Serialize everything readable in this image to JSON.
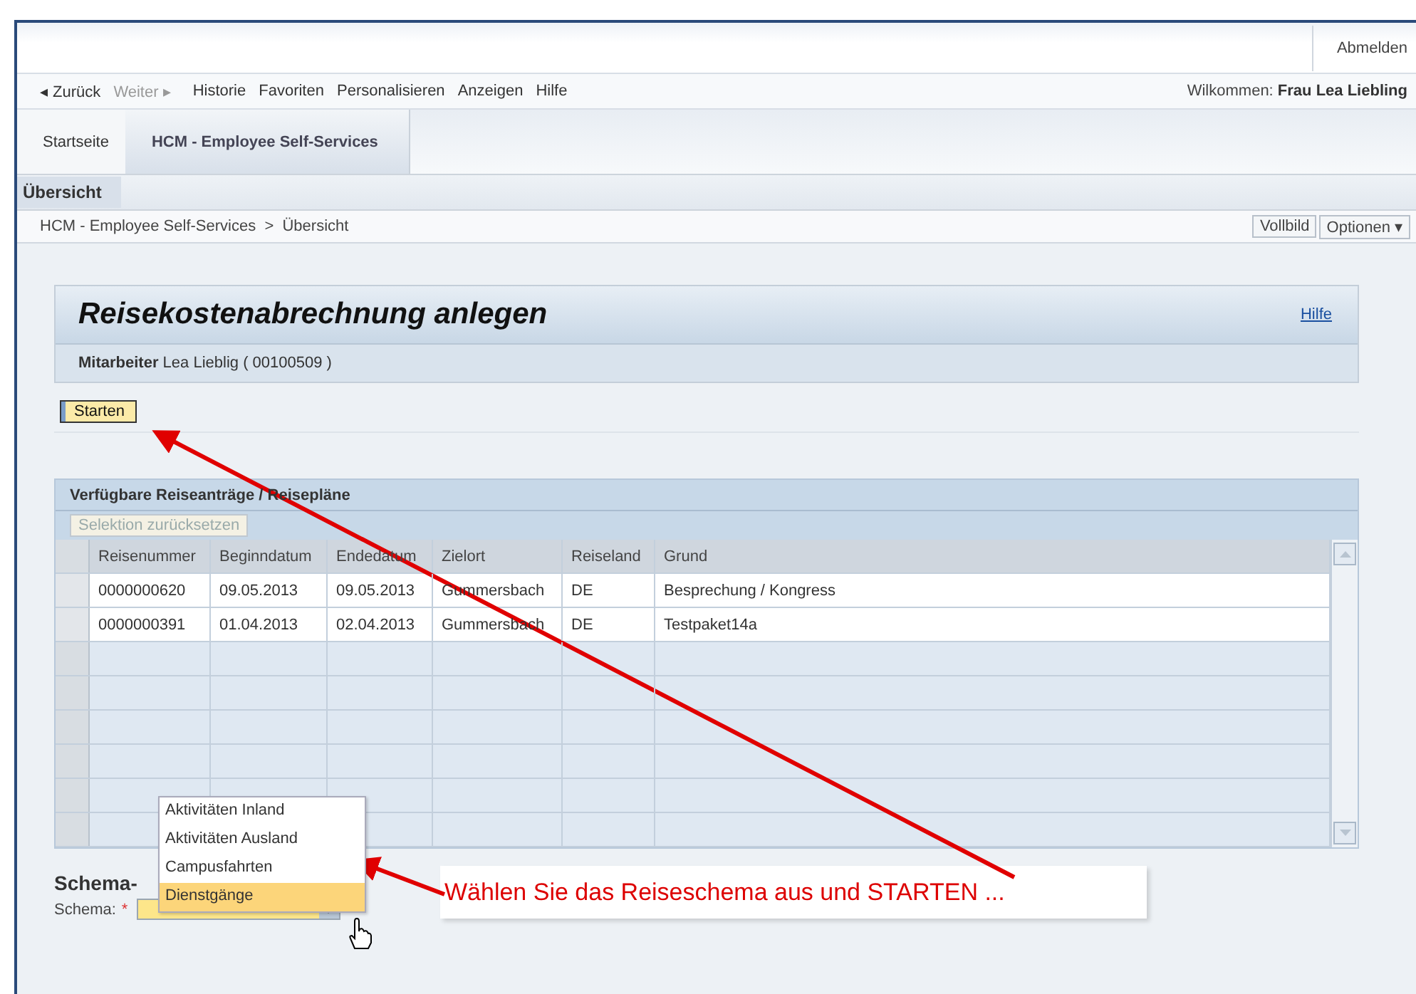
{
  "header": {
    "logout": "Abmelden"
  },
  "nav": {
    "back": "◂ Zurück",
    "forward": "Weiter ▸",
    "items": [
      "Historie",
      "Favoriten",
      "Personalisieren",
      "Anzeigen",
      "Hilfe"
    ],
    "welcome_label": "Wilkommen:",
    "welcome_name": "Frau Lea Liebling"
  },
  "tabs": [
    {
      "label": "Startseite",
      "selected": false
    },
    {
      "label": "HCM - Employee Self-Services",
      "selected": true
    }
  ],
  "subtabs": [
    {
      "label": "Übersicht",
      "selected": true
    }
  ],
  "breadcrumb": {
    "text": "HCM - Employee Self-Services  >  Übersicht",
    "buttons": [
      "Vollbild",
      "Optionen ▾"
    ]
  },
  "page": {
    "title": "Reisekostenabrechnung anlegen",
    "help": "Hilfe",
    "employee_label": "Mitarbeiter",
    "employee_value": "Lea Lieblig ( 00100509 )",
    "start_button": "Starten"
  },
  "table": {
    "title": "Verfügbare Reiseanträge / Reisepläne",
    "reset_button": "Selektion zurücksetzen",
    "disabled_reset": true,
    "columns": [
      "Reisenummer",
      "Beginndatum",
      "Endedatum",
      "Zielort",
      "Reiseland",
      "Grund"
    ],
    "rows": [
      [
        "0000000620",
        "09.05.2013",
        "09.05.2013",
        "Gummersbach",
        "DE",
        "Besprechung / Kongress"
      ],
      [
        "0000000391",
        "01.04.2013",
        "02.04.2013",
        "Gummersbach",
        "DE",
        "Testpaket14a"
      ]
    ]
  },
  "schema": {
    "heading": "Schema-",
    "label": "Schema:",
    "required_mark": "*",
    "options": [
      {
        "label": "Aktivitäten Inland",
        "selected": false
      },
      {
        "label": "Aktivitäten Ausland",
        "selected": false
      },
      {
        "label": "Campusfahrten",
        "selected": false
      },
      {
        "label": "Dienstgänge",
        "selected": true
      }
    ]
  },
  "callout": {
    "text": "Wählen Sie das Reiseschema aus und STARTEN ..."
  }
}
